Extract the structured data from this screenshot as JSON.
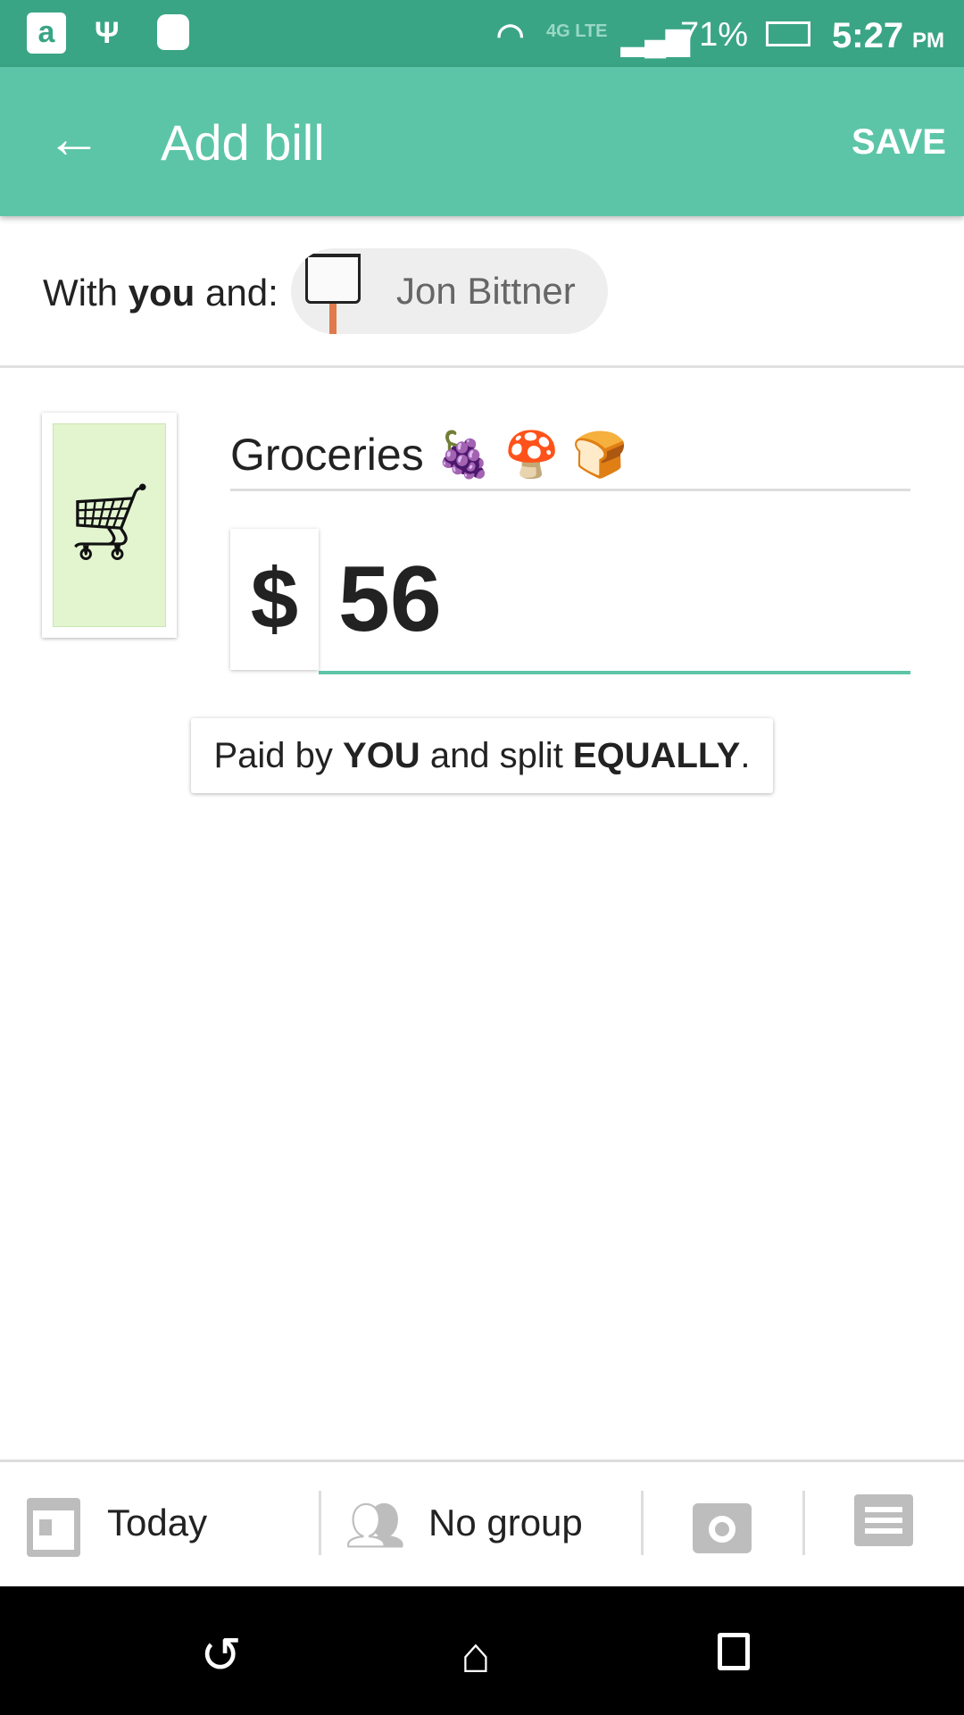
{
  "status_bar": {
    "battery": "71%",
    "time": "5:27",
    "ampm": "PM",
    "network": "4G LTE",
    "icons": [
      "amazon-icon",
      "usb-icon",
      "android-icon",
      "wifi-icon",
      "signal-icon",
      "battery-charging-icon"
    ]
  },
  "app_bar": {
    "title": "Add bill",
    "save_label": "SAVE",
    "back_icon": "arrow-left-icon"
  },
  "with": {
    "prefix": "With ",
    "you": "you",
    "suffix": " and:",
    "friend": "Jon Bittner"
  },
  "bill": {
    "description": "Groceries",
    "emoji": "🍇 🍄 🍞",
    "currency": "$",
    "amount": "56",
    "category_icon": "shopping-cart-icon"
  },
  "split": {
    "pre": "Paid by ",
    "payer": "YOU",
    "mid": " and split ",
    "method": "EQUALLY",
    "end": "."
  },
  "bottom_bar": {
    "date": "Today",
    "group": "No group"
  },
  "colors": {
    "accent": "#5cc5a7",
    "status": "#3aa585"
  }
}
